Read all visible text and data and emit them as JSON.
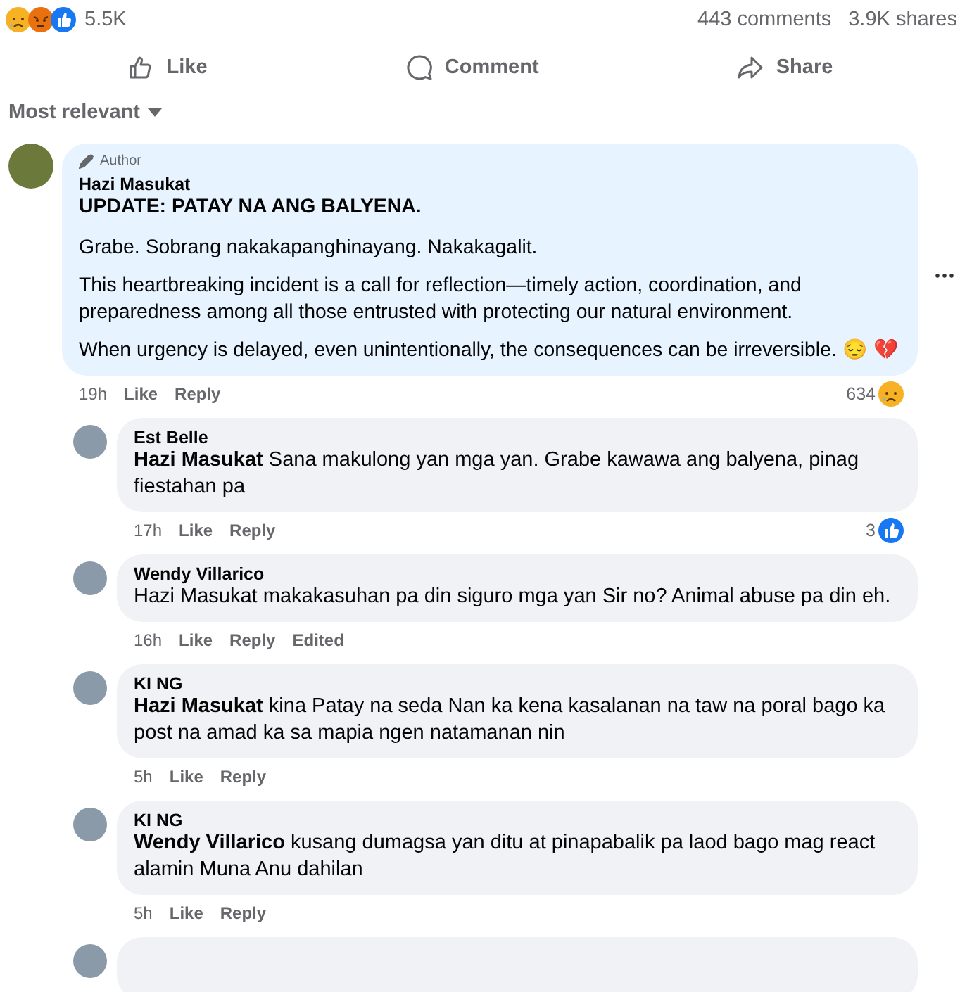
{
  "reactions": {
    "icons": [
      {
        "kind": "sad"
      },
      {
        "kind": "angry"
      },
      {
        "kind": "like"
      }
    ],
    "count": "5.5K"
  },
  "stats": {
    "comments": "443 comments",
    "shares": "3.9K shares"
  },
  "actions": [
    {
      "kind": "like",
      "label": "Like"
    },
    {
      "kind": "comment",
      "label": "Comment"
    },
    {
      "kind": "share",
      "label": "Share"
    }
  ],
  "sort": {
    "label": "Most relevant"
  },
  "comments": [
    {
      "kind": "top",
      "badge": "Author",
      "author": "Hazi Masukat",
      "paragraphs": [
        {
          "text": "UPDATE: PATAY NA ANG BALYENA.",
          "bold": true
        },
        {
          "text": "Grabe. Sobrang nakakapanghinayang. Nakakagalit.",
          "bold": false
        },
        {
          "text": "This heartbreaking incident is a call for reflection—timely action, coordination, and preparedness among all those entrusted with protecting our natural environment.",
          "bold": false
        },
        {
          "text": "When urgency is delayed, even unintentionally, the consequences can be irreversible. 😔 💔",
          "bold": false
        }
      ],
      "time": "19h",
      "links": [
        "Like",
        "Reply"
      ],
      "reaction": {
        "count": "634",
        "kind": "sad"
      }
    },
    {
      "kind": "reply",
      "author": "Est Belle",
      "paragraphs": [
        {
          "text": "**Hazi Masukat** Sana makulong yan mga yan. Grabe kawawa ang balyena, pinag fiestahan pa",
          "bold": false
        }
      ],
      "time": "17h",
      "links": [
        "Like",
        "Reply"
      ],
      "reaction": {
        "count": "3",
        "kind": "like"
      }
    },
    {
      "kind": "reply",
      "author": "Wendy Villarico",
      "paragraphs": [
        {
          "text": "Hazi Masukat makakasuhan pa din siguro mga yan Sir no? Animal abuse pa din eh.",
          "bold": false
        }
      ],
      "time": "16h",
      "links": [
        "Like",
        "Reply"
      ],
      "edited": "Edited"
    },
    {
      "kind": "reply",
      "author": "KI NG",
      "paragraphs": [
        {
          "text": "**Hazi Masukat** kina Patay na seda Nan ka kena kasalanan na taw na poral bago ka post na amad ka sa mapia ngen natamanan nin",
          "bold": false
        }
      ],
      "time": "5h",
      "links": [
        "Like",
        "Reply"
      ]
    },
    {
      "kind": "reply",
      "author": "KI NG",
      "paragraphs": [
        {
          "text": "**Wendy Villarico** kusang dumagsa yan ditu at pinapabalik pa laod bago mag react alamin Muna Anu dahilan",
          "bold": false
        }
      ],
      "time": "5h",
      "links": [
        "Like",
        "Reply"
      ]
    },
    {
      "kind": "cut"
    }
  ]
}
